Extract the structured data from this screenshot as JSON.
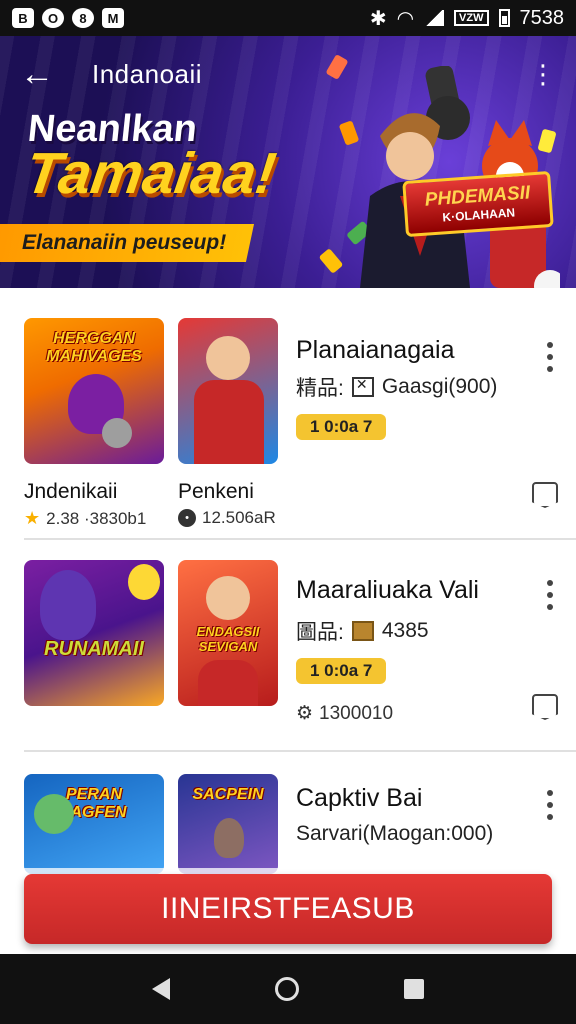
{
  "status_bar": {
    "left_icons": [
      "B",
      "O",
      "8",
      "M"
    ],
    "right_time": "7538",
    "battery_box": "VZW"
  },
  "banner": {
    "title": "Indanoaii",
    "headline_line1": "Neanlkan",
    "headline_line2": "Tamaiaa!",
    "ribbon_text": "Elananaiin peuseup!",
    "badge_line1": "PHDEMASII",
    "badge_line2": "K·OLAHAAN"
  },
  "items": [
    {
      "thumb_a": {
        "label": "HERGGAN MAHIVAGES",
        "name": "Jndenikaii",
        "meta": "2.38 ·3830b1"
      },
      "thumb_b": {
        "label": "",
        "name": "Penkeni",
        "meta": "12.506aR"
      },
      "title": "Planaianagaia",
      "sub_prefix": "精品:",
      "sub_text": "Gaasgi(900)",
      "badge": "1 0:0а 7",
      "gear_meta": ""
    },
    {
      "thumb_a": {
        "label": "RUNAMAII"
      },
      "thumb_b": {
        "label": "ENDAGSII SEVIGAN"
      },
      "title": "Maaraliuaka Vali",
      "sub_prefix": "圖品:",
      "sub_text": "4385",
      "badge": "1 0:0а 7",
      "gear_meta": "1300010"
    },
    {
      "thumb_a": {
        "label": "PERAN FAGFEN"
      },
      "thumb_b": {
        "label": "SACPEIN"
      },
      "title": "Capktiv Bai",
      "sub_text": "Sarvari(Maogan:000)"
    }
  ],
  "cta_label": "IINEIRSTFEASUB",
  "colors": {
    "accent": "#e53935",
    "badge": "#f4c430",
    "banner_bg": "#3b1e93"
  }
}
